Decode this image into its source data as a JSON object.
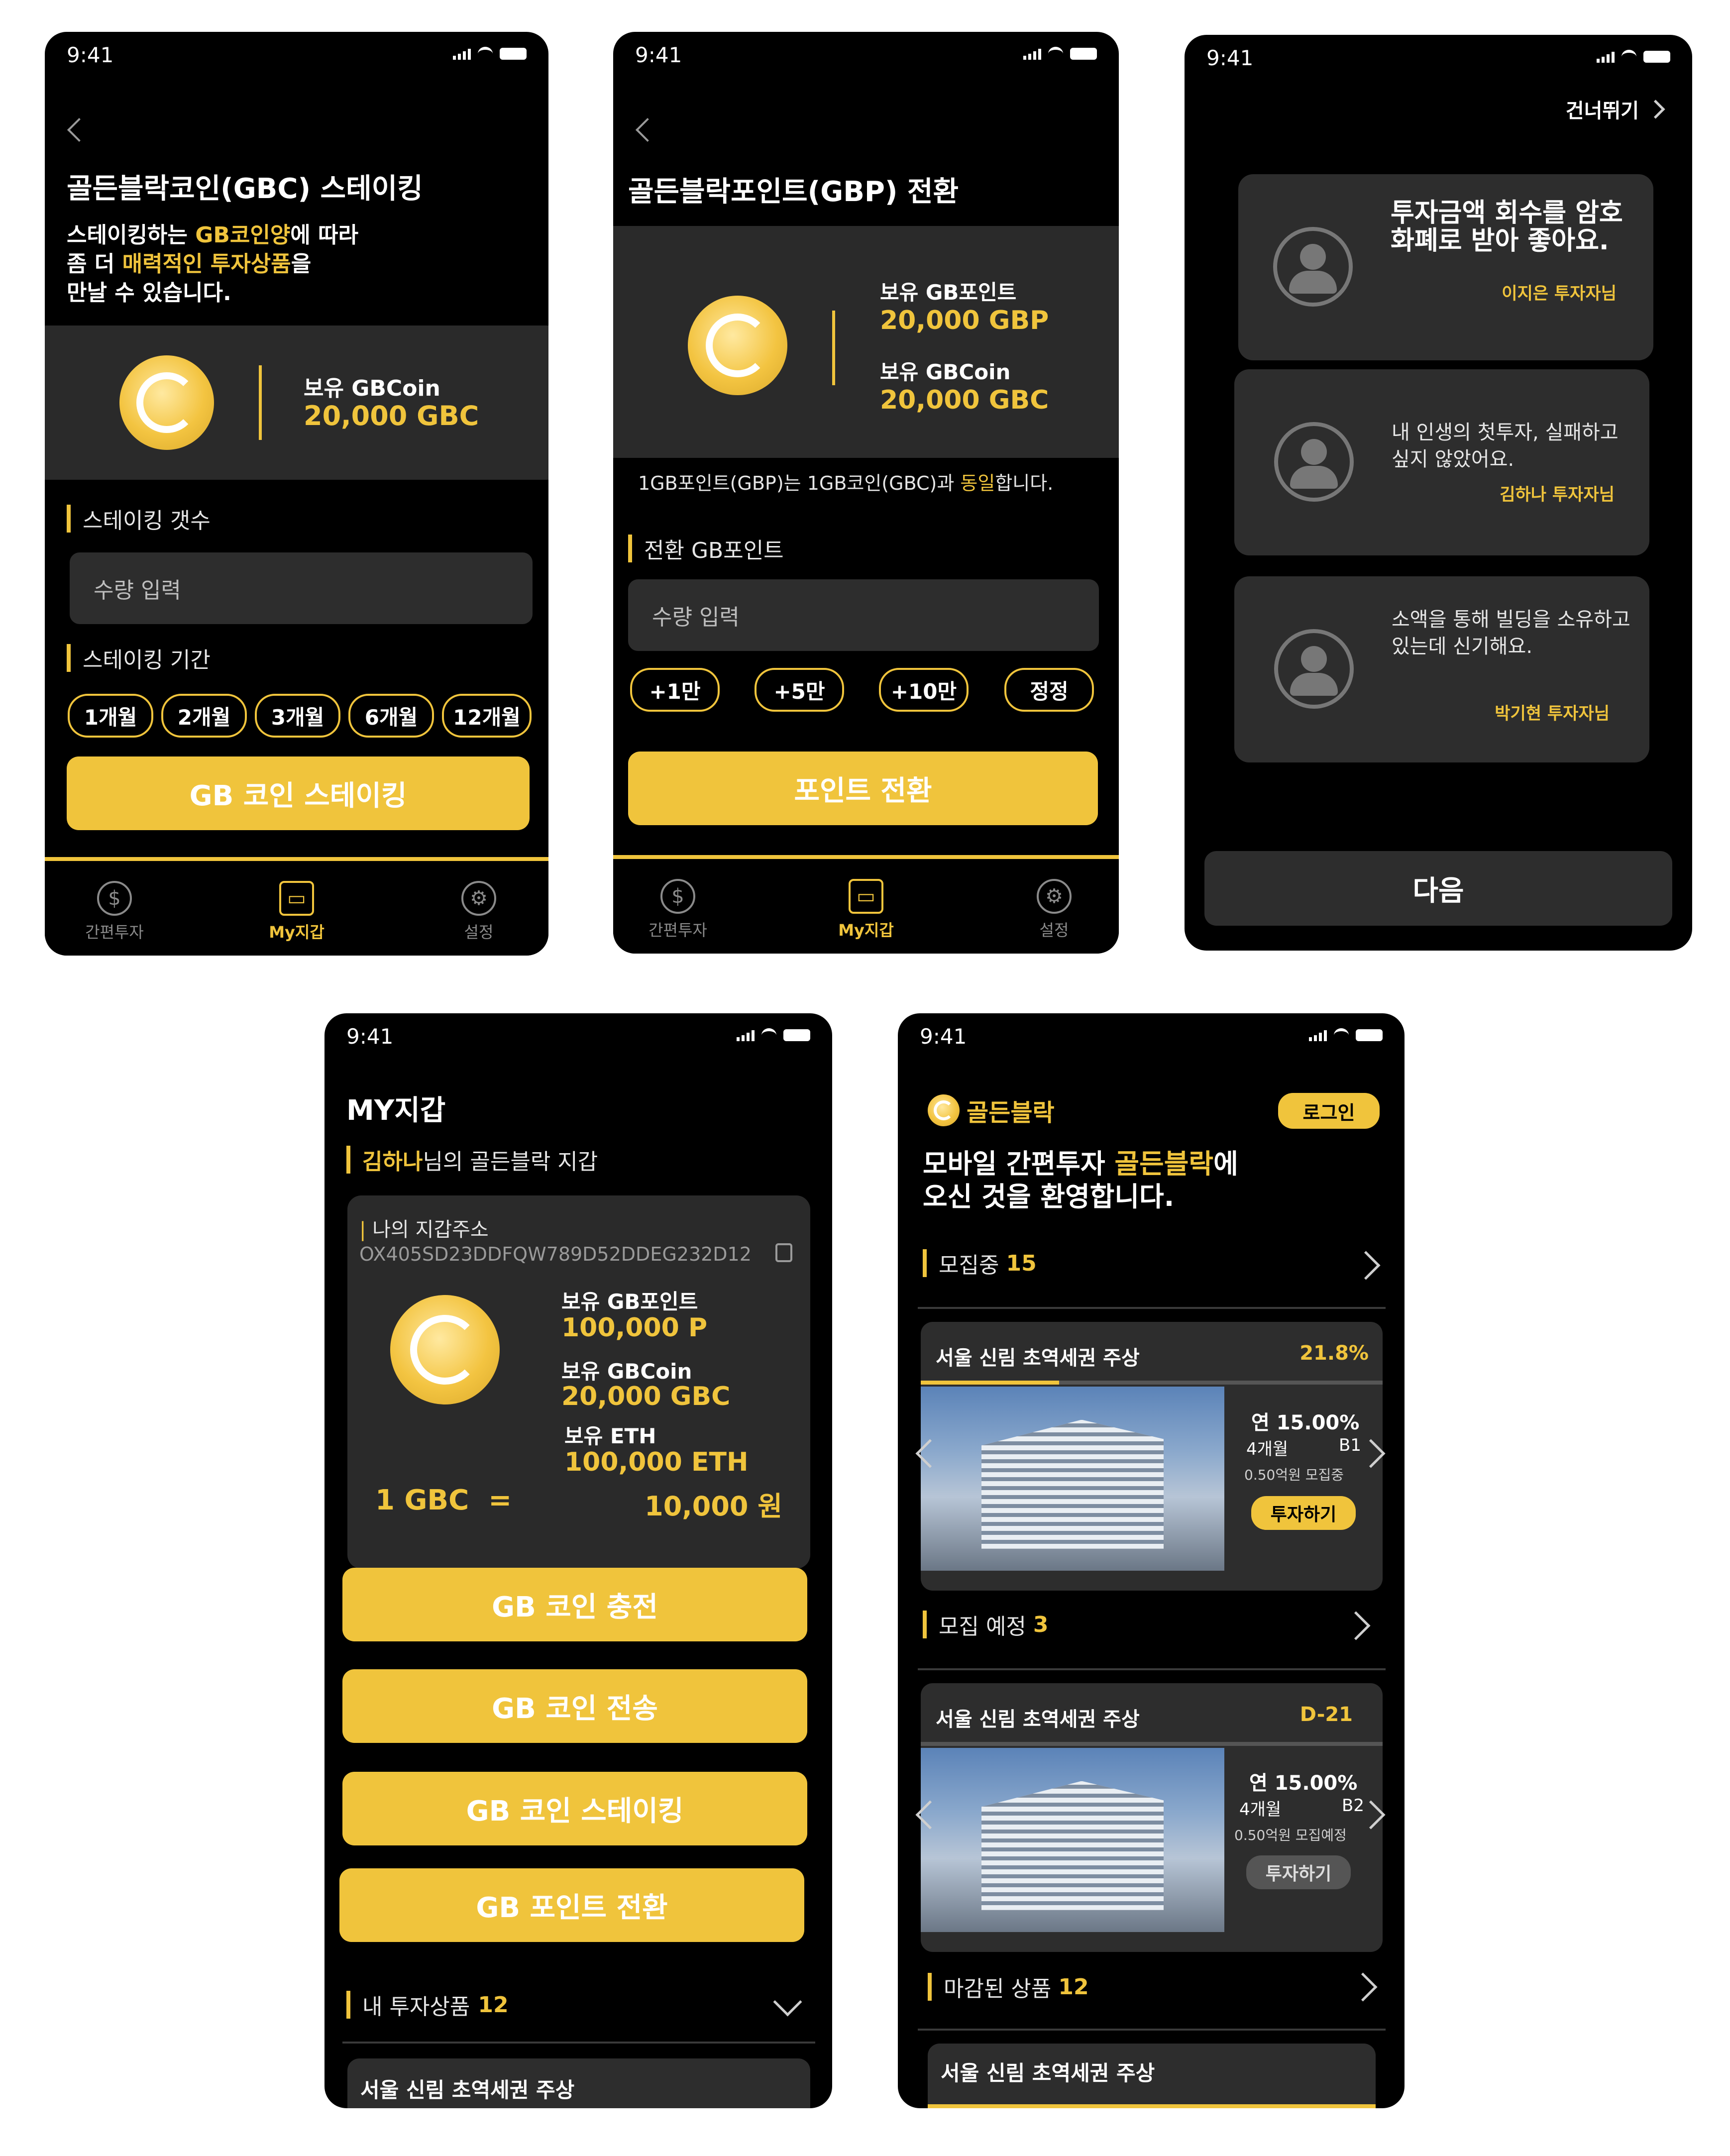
{
  "status_time": "9:41",
  "screen1": {
    "title": "골든블락코인(GBC) 스테이킹",
    "desc_l1_a": "스테이킹하는 ",
    "desc_l1_b": "GB코인양",
    "desc_l1_c": "에 따라",
    "desc_l2_a": "좀 더 ",
    "desc_l2_b": "매력적인 투자상품",
    "desc_l2_c": "을",
    "desc_l3": "만날 수 있습니다.",
    "balance_label": "보유 GBCoin",
    "balance_value": "20,000 GBC",
    "count_label": "스테이킹 갯수",
    "count_placeholder": "수량 입력",
    "period_label": "스테이킹 기간",
    "periods": [
      "1개월",
      "2개월",
      "3개월",
      "6개월",
      "12개월"
    ],
    "cta": "GB 코인 스테이킹",
    "tabs": [
      "간편투자",
      "My지갑",
      "설정"
    ]
  },
  "screen2": {
    "title": "골든블락포인트(GBP) 전환",
    "gbp_label": "보유 GB포인트",
    "gbp_value": "20,000 GBP",
    "gbc_label": "보유 GBCoin",
    "gbc_value": "20,000 GBC",
    "note_a": "1GB포인트(GBP)는 1GB코인(GBC)과 ",
    "note_b": "동일",
    "note_c": "합니다.",
    "convert_label": "전환 GB포인트",
    "placeholder": "수량 입력",
    "chips": [
      "+1만",
      "+5만",
      "+10만",
      "정정"
    ],
    "cta": "포인트 전환",
    "tabs": [
      "간편투자",
      "My지갑",
      "설정"
    ]
  },
  "screen3": {
    "skip": "건너뛰기",
    "reviews": [
      {
        "text": "투자금액 회수를 암호화폐로 받아 좋아요.",
        "author": "이지은 투자자님"
      },
      {
        "text": "내 인생의 첫투자, 실패하고 싶지 않았어요.",
        "author": "김하나 투자자님"
      },
      {
        "text": "소액을 통해 빌딩을 소유하고 있는데 신기해요.",
        "author": "박기현 투자자님"
      }
    ],
    "next": "다음"
  },
  "screen4": {
    "title": "MY지갑",
    "owner_name": "김하나",
    "owner_suffix": "님의 골든블락 지갑",
    "address_label": "나의 지갑주소",
    "address": "OX405SD23DDFQW789D52DDEG232D12",
    "gbp_label": "보유 GB포인트",
    "gbp_value": "100,000 P",
    "gbc_label": "보유 GBCoin",
    "gbc_value": "20,000 GBC",
    "eth_label": "보유 ETH",
    "eth_value": "100,000 ETH",
    "rate_left": "1 GBC  =",
    "rate_right": "10,000 원",
    "buttons": [
      "GB 코인 충전",
      "GB 코인 전송",
      "GB 코인 스테이킹",
      "GB 포인트 전환"
    ],
    "products_label": "내 투자상품",
    "products_count": "12",
    "product_name": "서울 신림 초역세권 주상"
  },
  "screen5": {
    "brand": "골든블락",
    "login": "로그인",
    "hero_l1_a": "모바일 간편투자 ",
    "hero_l1_b": "골든블락",
    "hero_l1_c": "에",
    "hero_l2": "오신 것을 환영합니다.",
    "section1_label": "모집중",
    "section1_count": "15",
    "card1": {
      "name": "서울 신림 초역세권 주상",
      "badge": "21.8%",
      "progress": 0.3,
      "rate": "연 15.00%",
      "period": "4개월",
      "grade": "B1",
      "amount": "0.50억원 모집중",
      "cta": "투자하기"
    },
    "section2_label": "모집 예정",
    "section2_count": "3",
    "card2": {
      "name": "서울 신림 초역세권 주상",
      "badge": "D-21",
      "rate": "연 15.00%",
      "period": "4개월",
      "grade": "B2",
      "amount": "0.50억원 모집예정",
      "cta": "투자하기"
    },
    "section3_label": "마감된 상품",
    "section3_count": "12",
    "product_name": "서울 신림 초역세권 주상"
  },
  "colors": {
    "accent": "#f0c43c",
    "bg": "#000000",
    "card": "#2d2d2d"
  }
}
